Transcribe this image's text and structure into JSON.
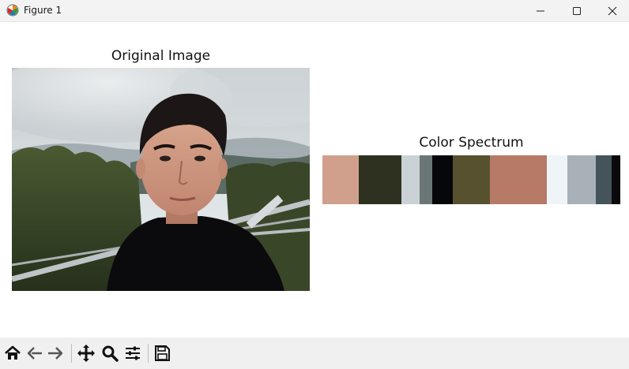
{
  "window": {
    "title": "Figure 1",
    "icons": [
      "matplotlib-logo-icon",
      "minimize-icon",
      "maximize-icon",
      "close-icon"
    ]
  },
  "figure": {
    "left_title": "Original Image",
    "right_title": "Color Spectrum",
    "photo_description_icon": "portrait-photo-image",
    "spectrum_colors": [
      {
        "color": "#d1a08d",
        "share": 12.2
      },
      {
        "color": "#2e3120",
        "share": 14.3
      },
      {
        "color": "#cbd2d6",
        "share": 6.1
      },
      {
        "color": "#6b7776",
        "share": 4.3
      },
      {
        "color": "#06070b",
        "share": 7.0
      },
      {
        "color": "#575130",
        "share": 12.4
      },
      {
        "color": "#b67a66",
        "share": 19.0
      },
      {
        "color": "#eef4f8",
        "share": 6.9
      },
      {
        "color": "#a8b1b7",
        "share": 9.6
      },
      {
        "color": "#44545a",
        "share": 5.3
      },
      {
        "color": "#0a0a0c",
        "share": 2.9
      }
    ]
  },
  "toolbar": {
    "icons": [
      "home-icon",
      "back-icon",
      "forward-icon",
      "pan-icon",
      "zoom-icon",
      "configure-subplots-icon",
      "save-icon"
    ]
  }
}
